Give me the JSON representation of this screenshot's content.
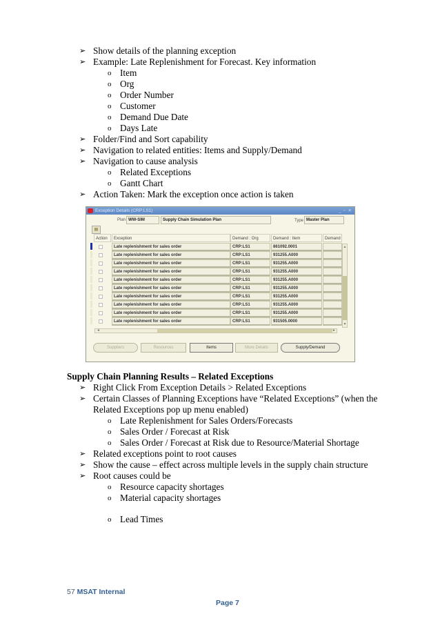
{
  "section1": {
    "bullets": [
      {
        "level": 1,
        "text": "Show details of the planning exception"
      },
      {
        "level": 1,
        "text": "Example: Late Replenishment for Forecast. Key information"
      },
      {
        "level": 2,
        "text": "Item"
      },
      {
        "level": 2,
        "text": "Org"
      },
      {
        "level": 2,
        "text": "Order Number"
      },
      {
        "level": 2,
        "text": "Customer"
      },
      {
        "level": 2,
        "text": "Demand Due Date"
      },
      {
        "level": 2,
        "text": "Days Late"
      },
      {
        "level": 1,
        "text": "Folder/Find and Sort capability"
      },
      {
        "level": 1,
        "text": "Navigation to related entities: Items and Supply/Demand"
      },
      {
        "level": 1,
        "text": "Navigation to cause analysis"
      },
      {
        "level": 2,
        "text": "Related Exceptions"
      },
      {
        "level": 2,
        "text": "Gantt Chart"
      },
      {
        "level": 1,
        "text": "Action Taken: Mark the exception once action is taken"
      }
    ]
  },
  "glyphs": {
    "arrow_bullet": "➢",
    "circle_bullet": "o"
  },
  "screenshot": {
    "title": "Exception Details (CRP:LS1)",
    "window_controls": "_ ▫ ✕",
    "plan_label": "Plan",
    "plan_value": "WW-SIM",
    "plan_description": "Supply Chain Simulation Plan",
    "type_label": "Type",
    "type_value": "Master Plan",
    "folder_icon": "▤",
    "columns": [
      "Action",
      "Exception",
      "Demand : Org",
      "Demand : Item",
      "Demand"
    ],
    "rows": [
      {
        "exception": "Late replenishment for sales order",
        "org": "CRP:LS1",
        "item": "861092.0001",
        "demand": ""
      },
      {
        "exception": "Late replenishment for sales order",
        "org": "CRP:LS1",
        "item": "931255.A000",
        "demand": ""
      },
      {
        "exception": "Late replenishment for sales order",
        "org": "CRP:LS1",
        "item": "931255.A000",
        "demand": ""
      },
      {
        "exception": "Late replenishment for sales order",
        "org": "CRP:LS1",
        "item": "931255.A000",
        "demand": ""
      },
      {
        "exception": "Late replenishment for sales order",
        "org": "CRP:LS1",
        "item": "931255.A000",
        "demand": ""
      },
      {
        "exception": "Late replenishment for sales order",
        "org": "CRP:LS1",
        "item": "931255.A000",
        "demand": ""
      },
      {
        "exception": "Late replenishment for sales order",
        "org": "CRP:LS1",
        "item": "931255.A000",
        "demand": ""
      },
      {
        "exception": "Late replenishment for sales order",
        "org": "CRP:LS1",
        "item": "931255.A000",
        "demand": ""
      },
      {
        "exception": "Late replenishment for sales order",
        "org": "CRP:LS1",
        "item": "931255.A000",
        "demand": ""
      },
      {
        "exception": "Late replenishment for sales order",
        "org": "CRP:LS1",
        "item": "931505.0000",
        "demand": ""
      }
    ],
    "buttons": [
      {
        "label": "Suppliers",
        "enabled": false
      },
      {
        "label": "Resources",
        "enabled": false
      },
      {
        "label": "Items",
        "enabled": true
      },
      {
        "label": "More Details",
        "enabled": false
      },
      {
        "label": "Supply/Demand",
        "enabled": true
      }
    ],
    "scroll_up": "▲",
    "scroll_down": "▼",
    "scroll_left": "◄",
    "scroll_right": "►"
  },
  "section2": {
    "heading": "Supply Chain Planning Results – Related Exceptions",
    "lines": [
      {
        "level": 1,
        "text": "Right Click From Exception Details > Related Exceptions"
      },
      {
        "level": 1,
        "text": "Certain Classes of Planning Exceptions have “Related Exceptions” (when the"
      },
      {
        "level": 0,
        "text": "Related Exceptions pop up menu enabled)"
      },
      {
        "level": 2,
        "text": "Late Replenishment for Sales Orders/Forecasts"
      },
      {
        "level": 2,
        "text": "Sales Order / Forecast at Risk"
      },
      {
        "level": 2,
        "text": "Sales Order / Forecast at Risk due to Resource/Material Shortage"
      },
      {
        "level": 1,
        "text": "Related exceptions point to root causes"
      },
      {
        "level": 1,
        "text": "Show the cause – effect across multiple levels in the supply chain structure"
      },
      {
        "level": 1,
        "text": "Root causes could be"
      },
      {
        "level": 2,
        "text": "Resource capacity shortages"
      },
      {
        "level": 2,
        "text": "Material capacity shortages"
      },
      {
        "level": 2,
        "text": "Lead Times"
      }
    ]
  },
  "footer": {
    "slide_number": "57",
    "label": "MSAT Internal",
    "page": "Page 7"
  }
}
